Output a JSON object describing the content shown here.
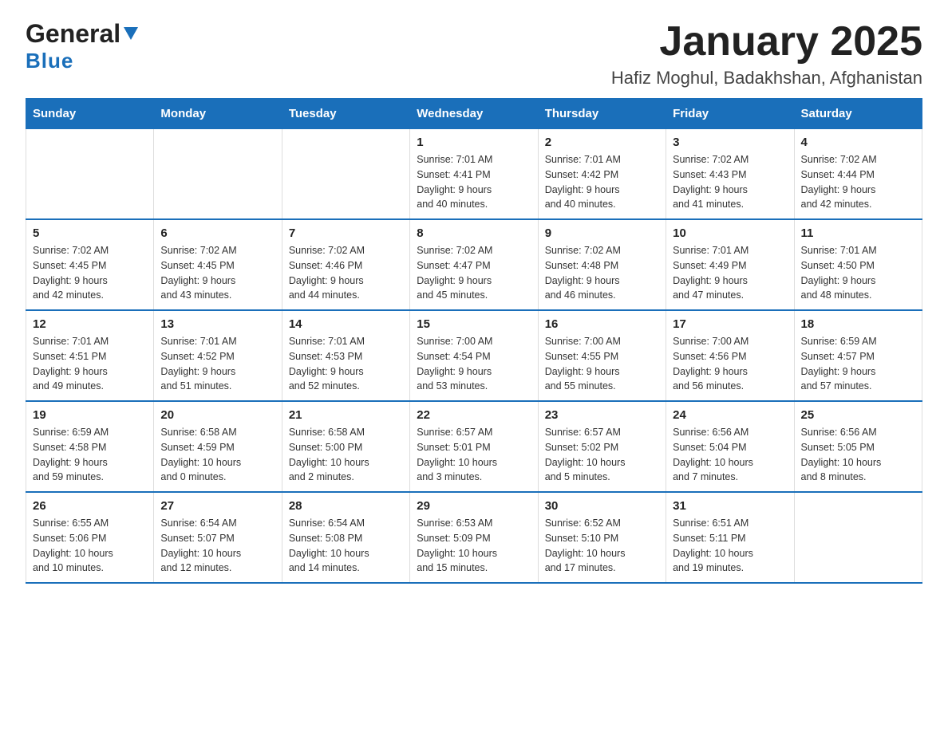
{
  "header": {
    "logo_general": "General",
    "logo_blue": "Blue",
    "title": "January 2025",
    "subtitle": "Hafiz Moghul, Badakhshan, Afghanistan"
  },
  "calendar": {
    "days_of_week": [
      "Sunday",
      "Monday",
      "Tuesday",
      "Wednesday",
      "Thursday",
      "Friday",
      "Saturday"
    ],
    "weeks": [
      [
        {
          "day": "",
          "info": ""
        },
        {
          "day": "",
          "info": ""
        },
        {
          "day": "",
          "info": ""
        },
        {
          "day": "1",
          "info": "Sunrise: 7:01 AM\nSunset: 4:41 PM\nDaylight: 9 hours\nand 40 minutes."
        },
        {
          "day": "2",
          "info": "Sunrise: 7:01 AM\nSunset: 4:42 PM\nDaylight: 9 hours\nand 40 minutes."
        },
        {
          "day": "3",
          "info": "Sunrise: 7:02 AM\nSunset: 4:43 PM\nDaylight: 9 hours\nand 41 minutes."
        },
        {
          "day": "4",
          "info": "Sunrise: 7:02 AM\nSunset: 4:44 PM\nDaylight: 9 hours\nand 42 minutes."
        }
      ],
      [
        {
          "day": "5",
          "info": "Sunrise: 7:02 AM\nSunset: 4:45 PM\nDaylight: 9 hours\nand 42 minutes."
        },
        {
          "day": "6",
          "info": "Sunrise: 7:02 AM\nSunset: 4:45 PM\nDaylight: 9 hours\nand 43 minutes."
        },
        {
          "day": "7",
          "info": "Sunrise: 7:02 AM\nSunset: 4:46 PM\nDaylight: 9 hours\nand 44 minutes."
        },
        {
          "day": "8",
          "info": "Sunrise: 7:02 AM\nSunset: 4:47 PM\nDaylight: 9 hours\nand 45 minutes."
        },
        {
          "day": "9",
          "info": "Sunrise: 7:02 AM\nSunset: 4:48 PM\nDaylight: 9 hours\nand 46 minutes."
        },
        {
          "day": "10",
          "info": "Sunrise: 7:01 AM\nSunset: 4:49 PM\nDaylight: 9 hours\nand 47 minutes."
        },
        {
          "day": "11",
          "info": "Sunrise: 7:01 AM\nSunset: 4:50 PM\nDaylight: 9 hours\nand 48 minutes."
        }
      ],
      [
        {
          "day": "12",
          "info": "Sunrise: 7:01 AM\nSunset: 4:51 PM\nDaylight: 9 hours\nand 49 minutes."
        },
        {
          "day": "13",
          "info": "Sunrise: 7:01 AM\nSunset: 4:52 PM\nDaylight: 9 hours\nand 51 minutes."
        },
        {
          "day": "14",
          "info": "Sunrise: 7:01 AM\nSunset: 4:53 PM\nDaylight: 9 hours\nand 52 minutes."
        },
        {
          "day": "15",
          "info": "Sunrise: 7:00 AM\nSunset: 4:54 PM\nDaylight: 9 hours\nand 53 minutes."
        },
        {
          "day": "16",
          "info": "Sunrise: 7:00 AM\nSunset: 4:55 PM\nDaylight: 9 hours\nand 55 minutes."
        },
        {
          "day": "17",
          "info": "Sunrise: 7:00 AM\nSunset: 4:56 PM\nDaylight: 9 hours\nand 56 minutes."
        },
        {
          "day": "18",
          "info": "Sunrise: 6:59 AM\nSunset: 4:57 PM\nDaylight: 9 hours\nand 57 minutes."
        }
      ],
      [
        {
          "day": "19",
          "info": "Sunrise: 6:59 AM\nSunset: 4:58 PM\nDaylight: 9 hours\nand 59 minutes."
        },
        {
          "day": "20",
          "info": "Sunrise: 6:58 AM\nSunset: 4:59 PM\nDaylight: 10 hours\nand 0 minutes."
        },
        {
          "day": "21",
          "info": "Sunrise: 6:58 AM\nSunset: 5:00 PM\nDaylight: 10 hours\nand 2 minutes."
        },
        {
          "day": "22",
          "info": "Sunrise: 6:57 AM\nSunset: 5:01 PM\nDaylight: 10 hours\nand 3 minutes."
        },
        {
          "day": "23",
          "info": "Sunrise: 6:57 AM\nSunset: 5:02 PM\nDaylight: 10 hours\nand 5 minutes."
        },
        {
          "day": "24",
          "info": "Sunrise: 6:56 AM\nSunset: 5:04 PM\nDaylight: 10 hours\nand 7 minutes."
        },
        {
          "day": "25",
          "info": "Sunrise: 6:56 AM\nSunset: 5:05 PM\nDaylight: 10 hours\nand 8 minutes."
        }
      ],
      [
        {
          "day": "26",
          "info": "Sunrise: 6:55 AM\nSunset: 5:06 PM\nDaylight: 10 hours\nand 10 minutes."
        },
        {
          "day": "27",
          "info": "Sunrise: 6:54 AM\nSunset: 5:07 PM\nDaylight: 10 hours\nand 12 minutes."
        },
        {
          "day": "28",
          "info": "Sunrise: 6:54 AM\nSunset: 5:08 PM\nDaylight: 10 hours\nand 14 minutes."
        },
        {
          "day": "29",
          "info": "Sunrise: 6:53 AM\nSunset: 5:09 PM\nDaylight: 10 hours\nand 15 minutes."
        },
        {
          "day": "30",
          "info": "Sunrise: 6:52 AM\nSunset: 5:10 PM\nDaylight: 10 hours\nand 17 minutes."
        },
        {
          "day": "31",
          "info": "Sunrise: 6:51 AM\nSunset: 5:11 PM\nDaylight: 10 hours\nand 19 minutes."
        },
        {
          "day": "",
          "info": ""
        }
      ]
    ]
  }
}
